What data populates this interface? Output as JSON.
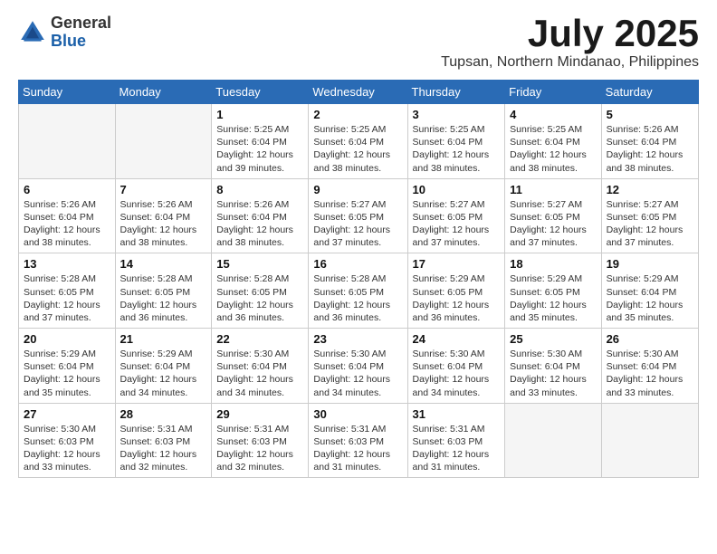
{
  "logo": {
    "general": "General",
    "blue": "Blue"
  },
  "title": "July 2025",
  "location": "Tupsan, Northern Mindanao, Philippines",
  "days_of_week": [
    "Sunday",
    "Monday",
    "Tuesday",
    "Wednesday",
    "Thursday",
    "Friday",
    "Saturday"
  ],
  "weeks": [
    [
      {
        "day": "",
        "empty": true
      },
      {
        "day": "",
        "empty": true
      },
      {
        "day": "1",
        "sunrise": "5:25 AM",
        "sunset": "6:04 PM",
        "daylight": "12 hours and 39 minutes."
      },
      {
        "day": "2",
        "sunrise": "5:25 AM",
        "sunset": "6:04 PM",
        "daylight": "12 hours and 38 minutes."
      },
      {
        "day": "3",
        "sunrise": "5:25 AM",
        "sunset": "6:04 PM",
        "daylight": "12 hours and 38 minutes."
      },
      {
        "day": "4",
        "sunrise": "5:25 AM",
        "sunset": "6:04 PM",
        "daylight": "12 hours and 38 minutes."
      },
      {
        "day": "5",
        "sunrise": "5:26 AM",
        "sunset": "6:04 PM",
        "daylight": "12 hours and 38 minutes."
      }
    ],
    [
      {
        "day": "6",
        "sunrise": "5:26 AM",
        "sunset": "6:04 PM",
        "daylight": "12 hours and 38 minutes."
      },
      {
        "day": "7",
        "sunrise": "5:26 AM",
        "sunset": "6:04 PM",
        "daylight": "12 hours and 38 minutes."
      },
      {
        "day": "8",
        "sunrise": "5:26 AM",
        "sunset": "6:04 PM",
        "daylight": "12 hours and 38 minutes."
      },
      {
        "day": "9",
        "sunrise": "5:27 AM",
        "sunset": "6:05 PM",
        "daylight": "12 hours and 37 minutes."
      },
      {
        "day": "10",
        "sunrise": "5:27 AM",
        "sunset": "6:05 PM",
        "daylight": "12 hours and 37 minutes."
      },
      {
        "day": "11",
        "sunrise": "5:27 AM",
        "sunset": "6:05 PM",
        "daylight": "12 hours and 37 minutes."
      },
      {
        "day": "12",
        "sunrise": "5:27 AM",
        "sunset": "6:05 PM",
        "daylight": "12 hours and 37 minutes."
      }
    ],
    [
      {
        "day": "13",
        "sunrise": "5:28 AM",
        "sunset": "6:05 PM",
        "daylight": "12 hours and 37 minutes."
      },
      {
        "day": "14",
        "sunrise": "5:28 AM",
        "sunset": "6:05 PM",
        "daylight": "12 hours and 36 minutes."
      },
      {
        "day": "15",
        "sunrise": "5:28 AM",
        "sunset": "6:05 PM",
        "daylight": "12 hours and 36 minutes."
      },
      {
        "day": "16",
        "sunrise": "5:28 AM",
        "sunset": "6:05 PM",
        "daylight": "12 hours and 36 minutes."
      },
      {
        "day": "17",
        "sunrise": "5:29 AM",
        "sunset": "6:05 PM",
        "daylight": "12 hours and 36 minutes."
      },
      {
        "day": "18",
        "sunrise": "5:29 AM",
        "sunset": "6:05 PM",
        "daylight": "12 hours and 35 minutes."
      },
      {
        "day": "19",
        "sunrise": "5:29 AM",
        "sunset": "6:04 PM",
        "daylight": "12 hours and 35 minutes."
      }
    ],
    [
      {
        "day": "20",
        "sunrise": "5:29 AM",
        "sunset": "6:04 PM",
        "daylight": "12 hours and 35 minutes."
      },
      {
        "day": "21",
        "sunrise": "5:29 AM",
        "sunset": "6:04 PM",
        "daylight": "12 hours and 34 minutes."
      },
      {
        "day": "22",
        "sunrise": "5:30 AM",
        "sunset": "6:04 PM",
        "daylight": "12 hours and 34 minutes."
      },
      {
        "day": "23",
        "sunrise": "5:30 AM",
        "sunset": "6:04 PM",
        "daylight": "12 hours and 34 minutes."
      },
      {
        "day": "24",
        "sunrise": "5:30 AM",
        "sunset": "6:04 PM",
        "daylight": "12 hours and 34 minutes."
      },
      {
        "day": "25",
        "sunrise": "5:30 AM",
        "sunset": "6:04 PM",
        "daylight": "12 hours and 33 minutes."
      },
      {
        "day": "26",
        "sunrise": "5:30 AM",
        "sunset": "6:04 PM",
        "daylight": "12 hours and 33 minutes."
      }
    ],
    [
      {
        "day": "27",
        "sunrise": "5:30 AM",
        "sunset": "6:03 PM",
        "daylight": "12 hours and 33 minutes."
      },
      {
        "day": "28",
        "sunrise": "5:31 AM",
        "sunset": "6:03 PM",
        "daylight": "12 hours and 32 minutes."
      },
      {
        "day": "29",
        "sunrise": "5:31 AM",
        "sunset": "6:03 PM",
        "daylight": "12 hours and 32 minutes."
      },
      {
        "day": "30",
        "sunrise": "5:31 AM",
        "sunset": "6:03 PM",
        "daylight": "12 hours and 31 minutes."
      },
      {
        "day": "31",
        "sunrise": "5:31 AM",
        "sunset": "6:03 PM",
        "daylight": "12 hours and 31 minutes."
      },
      {
        "day": "",
        "empty": true
      },
      {
        "day": "",
        "empty": true
      }
    ]
  ]
}
